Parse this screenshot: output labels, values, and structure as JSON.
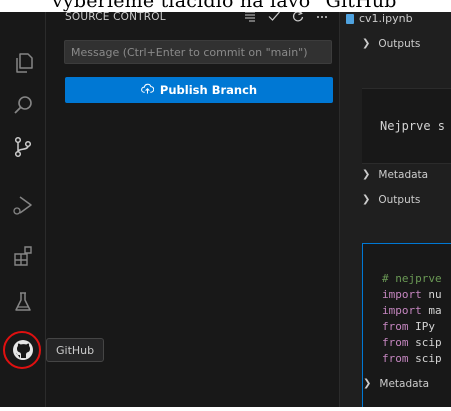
{
  "caption": {
    "text": "vyberieme tlačidlo na ľavo \"GitHub\""
  },
  "activity_bar": {
    "items": [
      {
        "name": "explorer",
        "icon": "files-icon"
      },
      {
        "name": "search",
        "icon": "search-icon"
      },
      {
        "name": "source-control",
        "icon": "source-control-icon"
      },
      {
        "name": "run-and-debug",
        "icon": "run-debug-icon"
      },
      {
        "name": "extensions",
        "icon": "extensions-icon"
      },
      {
        "name": "testing",
        "icon": "flask-icon"
      },
      {
        "name": "github",
        "icon": "github-icon"
      }
    ],
    "tooltip": "GitHub",
    "highlight_color": "#e01010"
  },
  "sidebar": {
    "title": "SOURCE CONTROL",
    "actions": [
      "list-icon",
      "check-icon",
      "refresh-icon",
      "more-icon"
    ],
    "commit_message_placeholder": "Message (Ctrl+Enter to commit on \"main\")",
    "publish_button": "Publish Branch",
    "accent": "#0078d4"
  },
  "editor": {
    "tab": "cv1.ipynb",
    "outputs_label": "Outputs",
    "metadata_label": "Metadata",
    "markdown_text": "Nejprve s",
    "code_lines": [
      {
        "kind": "comment",
        "text": "# nejprve"
      },
      {
        "kind": "import",
        "keyword": "import",
        "rest": " nu"
      },
      {
        "kind": "import",
        "keyword": "import",
        "rest": " ma"
      },
      {
        "kind": "import",
        "keyword": "from",
        "rest": " IPy"
      },
      {
        "kind": "import",
        "keyword": "from",
        "rest": " scip"
      },
      {
        "kind": "import",
        "keyword": "from",
        "rest": " scip"
      }
    ]
  }
}
